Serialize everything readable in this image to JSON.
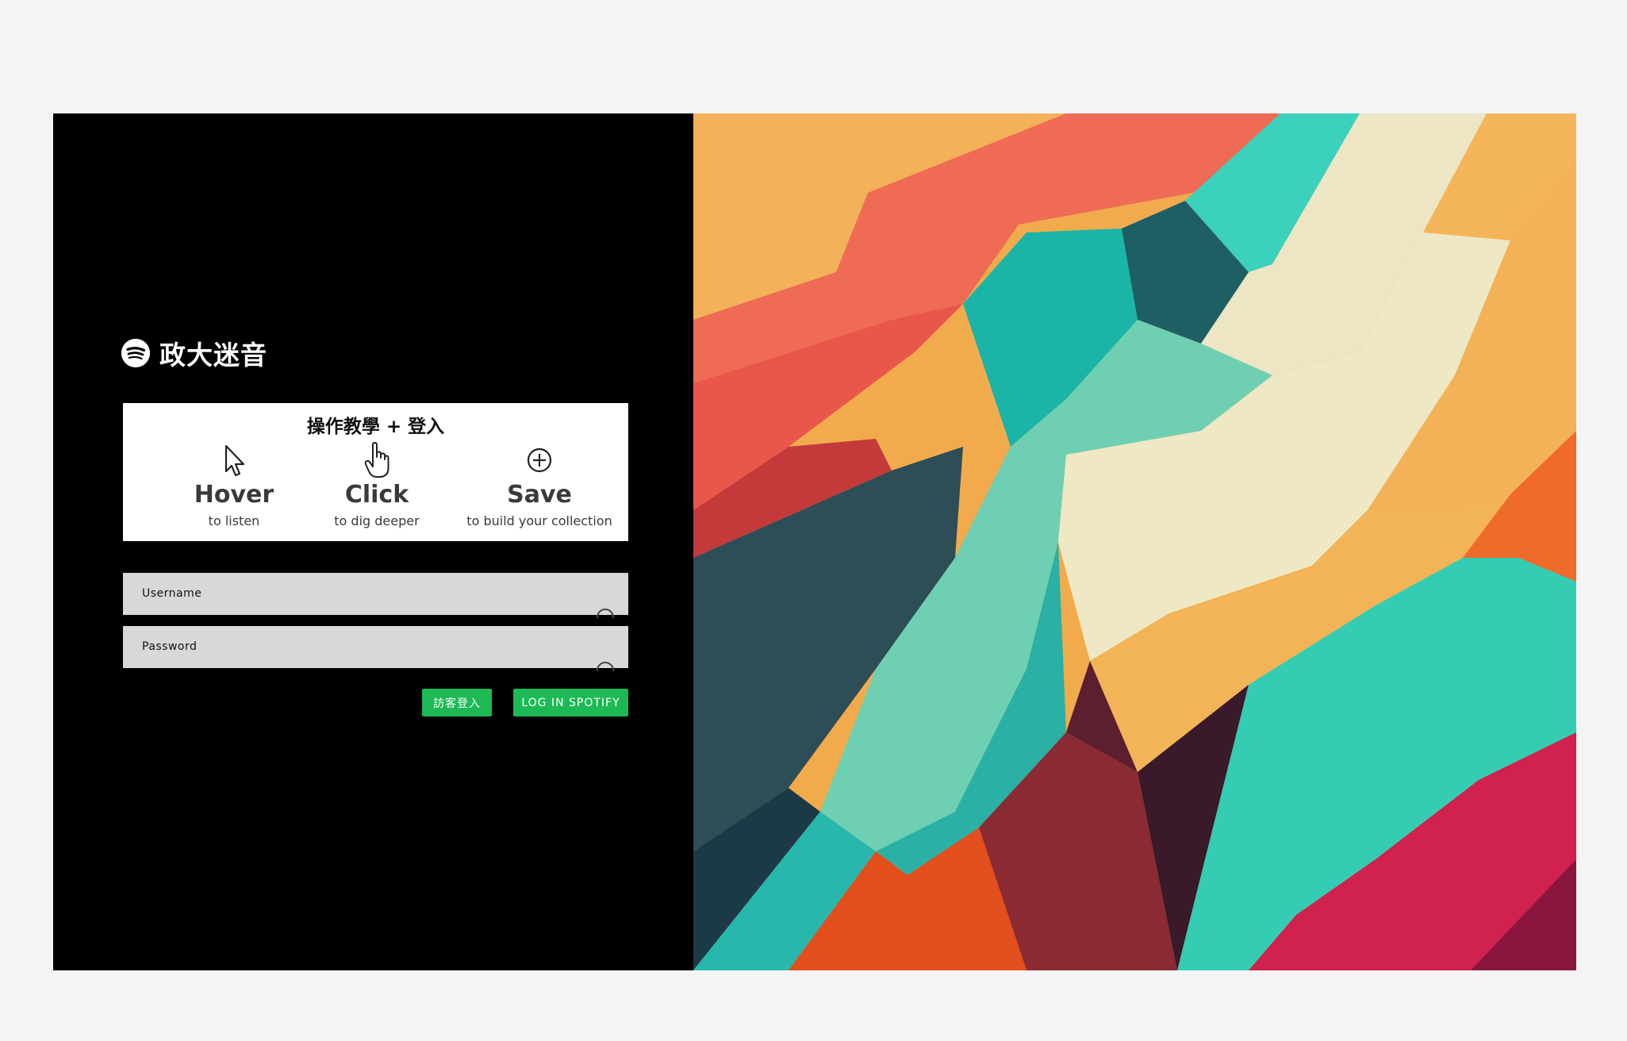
{
  "brand": {
    "title": "政大迷音",
    "icon": "spotify-icon"
  },
  "tutorial": {
    "title": "操作教學 + 登入",
    "steps": [
      {
        "icon": "cursor-pointer-icon",
        "name": "Hover",
        "desc": "to listen"
      },
      {
        "icon": "hand-click-icon",
        "name": "Click",
        "desc": "to dig deeper"
      },
      {
        "icon": "plus-circle-icon",
        "name": "Save",
        "desc": "to build your collection"
      }
    ]
  },
  "form": {
    "username_label": "Username",
    "password_label": "Password"
  },
  "buttons": {
    "guest_label": "訪客登入",
    "spotify_label": "LOG IN SPOTIFY"
  },
  "colors": {
    "accent": "#1db954",
    "panel_bg": "#000000",
    "page_bg": "#f4f4f4"
  }
}
